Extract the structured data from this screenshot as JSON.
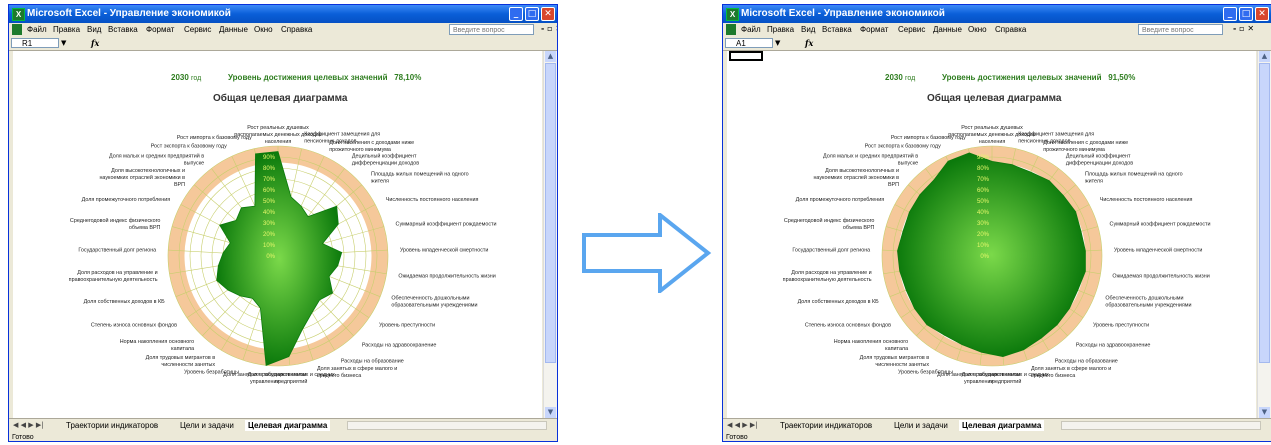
{
  "window_title": "Microsoft Excel - Управление экономикой",
  "menu": [
    "Файл",
    "Правка",
    "Вид",
    "Вставка",
    "Формат",
    "Сервис",
    "Данные",
    "Окно",
    "Справка"
  ],
  "ask_placeholder": "Введите вопрос",
  "tabs": [
    "Траектории индикаторов",
    "Цели и задачи",
    "Целевая диаграмма"
  ],
  "tab_nav": "◀ ◀ ▶ ▶|",
  "status": "Готово",
  "chart_title": "Общая целевая диаграмма",
  "year_unit": "год",
  "level_label": "Уровень достижения целевых значений",
  "ticks": [
    "0%",
    "10%",
    "20%",
    "30%",
    "40%",
    "50%",
    "60%",
    "70%",
    "80%",
    "90%"
  ],
  "colors": {
    "fill": "#2eb52e",
    "fill_dark": "#0c7a0c",
    "band": "#f5c89a",
    "grid": "#c8cf6e",
    "header": "#2e7d1f"
  },
  "chart_data": {
    "type": "radar",
    "categories": [
      "Рост реальных душевых располагаемых денежных доходов населения",
      "Коэффициент замещения для пенсионных доходов",
      "Доля населения с доходами ниже прожиточного минимума",
      "Децильный коэффициент дифференциации доходов",
      "Площадь жилых помещений на одного жителя",
      "Численность постоянного населения",
      "Суммарный коэффициент рождаемости",
      "Уровень младенческой смертности",
      "Ожидаемая продолжительность жизни",
      "Обеспеченность дошкольными образовательными учреждениями",
      "Уровень преступности",
      "Расходы на здравоохранение",
      "Расходы на образование",
      "Доля занятых в сфере малого и среднего бизнеса",
      "Доля работников малых и средних предприятий",
      "Доля занятых в государственном управлении",
      "Уровень безработицы",
      "Доля трудовых мигрантов в численности занятых",
      "Норма накопления основного капитала",
      "Степень износа основных фондов",
      "Доля собственных доходов в КБ",
      "Доля расходов на управление и правоохранительную деятельность",
      "Государственный долг региона",
      "Среднегодовой индекс физического объема ВРП",
      "Доля промежуточного потребления",
      "Доля высокотехнологичных и наукоемких отраслей экономики в ВРП",
      "Доля малых и средних предприятий в выпуске",
      "Рост экспорта к базовому году",
      "Рост импорта к базовому году"
    ],
    "series": [
      {
        "year": "2030",
        "level": "78,10%",
        "values": [
          0.95,
          0.55,
          0.5,
          0.45,
          0.7,
          0.62,
          0.42,
          0.58,
          0.55,
          0.5,
          0.6,
          0.55,
          0.6,
          0.7,
          0.92,
          1.0,
          0.5,
          0.45,
          0.5,
          0.55,
          0.6,
          0.55,
          0.5,
          0.45,
          0.6,
          0.5,
          0.55,
          0.5,
          0.95
        ]
      },
      {
        "year": "2030",
        "level": "91,50%",
        "values": [
          0.86,
          0.85,
          0.84,
          0.86,
          0.85,
          0.86,
          0.84,
          0.85,
          0.86,
          0.84,
          0.85,
          0.86,
          0.87,
          0.9,
          0.92,
          0.88,
          0.85,
          0.84,
          0.86,
          0.85,
          0.84,
          0.85,
          0.86,
          0.84,
          0.85,
          0.86,
          0.87,
          0.95,
          0.96
        ]
      }
    ]
  },
  "panels": [
    {
      "namebox": "R1",
      "year": "2030",
      "level": "78,10%"
    },
    {
      "namebox": "A1",
      "year": "2030",
      "level": "91,50%"
    }
  ]
}
